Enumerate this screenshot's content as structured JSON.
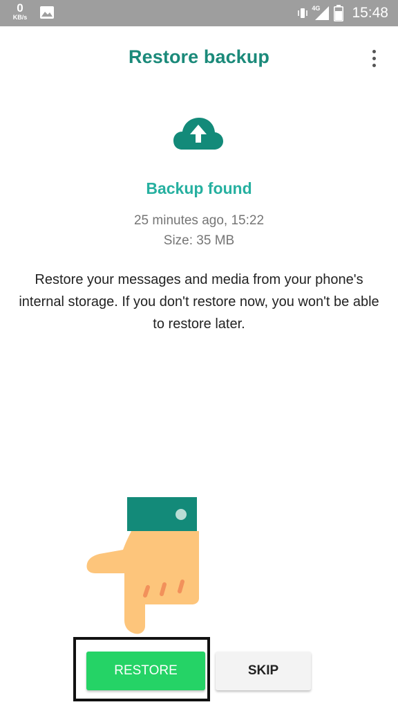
{
  "status_bar": {
    "speed_value": "0",
    "speed_unit": "KB/s",
    "network_type": "4G",
    "time": "15:48",
    "background_color": "#9e9e9e",
    "icons": [
      "image-icon",
      "vibrate-icon",
      "signal-icon",
      "battery-icon"
    ]
  },
  "header": {
    "title": "Restore backup",
    "menu_icon": "more-vert-icon"
  },
  "backup": {
    "icon": "cloud-upload-icon",
    "title": "Backup found",
    "time": "25 minutes ago, 15:22",
    "size": "Size: 35 MB",
    "description": "Restore your messages and media from your phone's internal storage. If you don't restore now, you won't be able to restore later."
  },
  "overlay": {
    "pointer_icon": "pointing-hand-icon"
  },
  "actions": {
    "restore_label": "RESTORE",
    "skip_label": "SKIP"
  },
  "colors": {
    "accent": "#1b8a7a",
    "accent_light": "#26b0a0",
    "restore_button": "#25d366",
    "hand_skin": "#fdc57b",
    "cuff": "#138a79"
  }
}
